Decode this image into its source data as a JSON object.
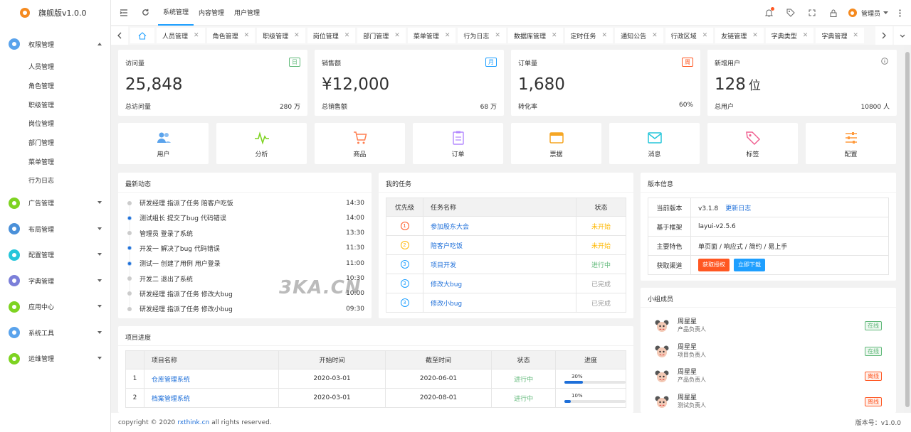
{
  "app": {
    "title": "旗舰版v1.0.0",
    "brand_color": "#f58a1f",
    "accent": "#1e9fff"
  },
  "sidebar": {
    "groups": [
      {
        "label": "权限管理",
        "color": "#5aa3ec",
        "expanded": true,
        "items": [
          "人员管理",
          "角色管理",
          "职级管理",
          "岗位管理",
          "部门管理",
          "菜单管理",
          "行为日志"
        ]
      },
      {
        "label": "广告管理",
        "color": "#7ed321"
      },
      {
        "label": "布局管理",
        "color": "#4a90d9"
      },
      {
        "label": "配置管理",
        "color": "#26c6da"
      },
      {
        "label": "字典管理",
        "color": "#7b7fd9"
      },
      {
        "label": "应用中心",
        "color": "#7ed321"
      },
      {
        "label": "系统工具",
        "color": "#5aa3ec"
      },
      {
        "label": "运维管理",
        "color": "#7ed321"
      }
    ]
  },
  "topbar": {
    "tabs": [
      "系统管理",
      "内容管理",
      "用户管理"
    ],
    "active_tab": 0,
    "user": "管理员"
  },
  "page_tabs": [
    "人员管理",
    "角色管理",
    "职级管理",
    "岗位管理",
    "部门管理",
    "菜单管理",
    "行为日志",
    "数据库管理",
    "定时任务",
    "通知公告",
    "行政区域",
    "友链管理",
    "字典类型",
    "字典管理"
  ],
  "stats": [
    {
      "title": "访问量",
      "badge": "日",
      "badge_color": "#5fb878",
      "value": "25,848",
      "unit": "",
      "label": "总访问量",
      "sub": "280 万"
    },
    {
      "title": "销售额",
      "badge": "月",
      "badge_color": "#1e9fff",
      "value": "¥12,000",
      "unit": "",
      "label": "总销售额",
      "sub": "68 万"
    },
    {
      "title": "订单量",
      "badge": "周",
      "badge_color": "#ff5722",
      "value": "1,680",
      "unit": "",
      "label": "转化率",
      "sub": "60%"
    },
    {
      "title": "新增用户",
      "badge": "",
      "value": "128",
      "unit": "位",
      "label": "总用户",
      "sub": "10800 人"
    }
  ],
  "quick": [
    {
      "label": "用户",
      "icon": "users-icon",
      "color": "#5aa3ec"
    },
    {
      "label": "分析",
      "icon": "pulse-icon",
      "color": "#7ed321"
    },
    {
      "label": "商品",
      "icon": "cart-icon",
      "color": "#ff7f50"
    },
    {
      "label": "订单",
      "icon": "clipboard-icon",
      "color": "#b388ff"
    },
    {
      "label": "票据",
      "icon": "card-icon",
      "color": "#f5a623"
    },
    {
      "label": "消息",
      "icon": "mail-icon",
      "color": "#26c6da"
    },
    {
      "label": "标签",
      "icon": "tag-icon",
      "color": "#f06292"
    },
    {
      "label": "配置",
      "icon": "sliders-icon",
      "color": "#ff9a3c"
    }
  ],
  "activity": {
    "title": "最新动态",
    "items": [
      {
        "text": "研发经理 指派了任务 陪客户吃饭",
        "time": "14:30",
        "blue": false
      },
      {
        "text": "测试组长 提交了bug 代码错误",
        "time": "14:00",
        "blue": true
      },
      {
        "text": "管理员 登录了系统",
        "time": "13:30",
        "blue": false
      },
      {
        "text": "开发一 解决了bug 代码错误",
        "time": "11:30",
        "blue": true
      },
      {
        "text": "测试一 创建了用例 用户登录",
        "time": "11:00",
        "blue": true
      },
      {
        "text": "开发二 退出了系统",
        "time": "10:30",
        "blue": false
      },
      {
        "text": "研发经理 指派了任务 修改大bug",
        "time": "10:00",
        "blue": false
      },
      {
        "text": "研发经理 指派了任务 修改小bug",
        "time": "09:30",
        "blue": false
      }
    ]
  },
  "tasks": {
    "title": "我的任务",
    "headers": [
      "优先级",
      "任务名称",
      "状态"
    ],
    "rows": [
      {
        "p": "1",
        "pc": "#ff5722",
        "name": "参加股东大会",
        "status": "未开始",
        "sc": "#ffb800"
      },
      {
        "p": "2",
        "pc": "#ffb800",
        "name": "陪客户吃饭",
        "status": "未开始",
        "sc": "#ffb800"
      },
      {
        "p": "3",
        "pc": "#1e9fff",
        "name": "项目开发",
        "status": "进行中",
        "sc": "#5fb878"
      },
      {
        "p": "3",
        "pc": "#1e9fff",
        "name": "修改大bug",
        "status": "已完成",
        "sc": "#999999"
      },
      {
        "p": "3",
        "pc": "#1e9fff",
        "name": "修改小bug",
        "status": "已完成",
        "sc": "#999999"
      }
    ]
  },
  "version": {
    "title": "版本信息",
    "rows": [
      {
        "k": "当前版本",
        "v": "v3.1.8",
        "link": "更新日志"
      },
      {
        "k": "基于框架",
        "v": "layui-v2.5.6"
      },
      {
        "k": "主要特色",
        "v": "单页面 / 响应式 / 简约 / 易上手"
      },
      {
        "k": "获取渠道",
        "btn1": "获取授权",
        "btn2": "立即下载"
      }
    ]
  },
  "members": {
    "title": "小组成员",
    "items": [
      {
        "name": "周星星",
        "role": "产品负责人",
        "status": "在线",
        "sc": "#5fb878"
      },
      {
        "name": "周星星",
        "role": "项目负责人",
        "status": "在线",
        "sc": "#5fb878"
      },
      {
        "name": "周星星",
        "role": "产品负责人",
        "status": "离线",
        "sc": "#ff5722"
      },
      {
        "name": "周星星",
        "role": "测试负责人",
        "status": "离线",
        "sc": "#ff5722"
      }
    ]
  },
  "projects": {
    "title": "项目进度",
    "headers": [
      "项目名称",
      "开始时间",
      "截至时间",
      "状态",
      "进度"
    ],
    "rows": [
      {
        "no": "1",
        "name": "仓库管理系统",
        "start": "2020-03-01",
        "end": "2020-06-01",
        "status": "进行中",
        "progress": 30,
        "plabel": "30%"
      },
      {
        "no": "2",
        "name": "档案管理系统",
        "start": "2020-03-01",
        "end": "2020-08-01",
        "status": "进行中",
        "progress": 10,
        "plabel": "10%"
      }
    ]
  },
  "footer": {
    "copyright": "copyright © 2020",
    "link": "rxthink.cn",
    "rights": "all rights reserved.",
    "version": "版本号：v1.0.0"
  },
  "watermark": "3KA.CN"
}
